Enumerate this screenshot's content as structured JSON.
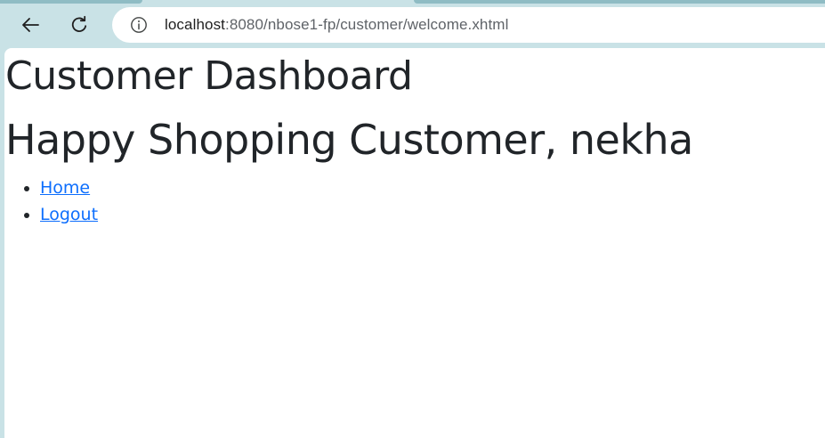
{
  "browser": {
    "url_host": "localhost",
    "url_rest": ":8080/nbose1-fp/customer/welcome.xhtml"
  },
  "page": {
    "title": "Customer Dashboard",
    "greeting": "Happy Shopping Customer, nekha",
    "nav_links": [
      {
        "label": "Home"
      },
      {
        "label": "Logout"
      }
    ]
  },
  "colors": {
    "frame": "#c9e2e6",
    "link": "#0d6efd",
    "text": "#212529"
  },
  "icons": {
    "back": "back-arrow-icon",
    "reload": "reload-icon",
    "site_info": "info-icon"
  }
}
